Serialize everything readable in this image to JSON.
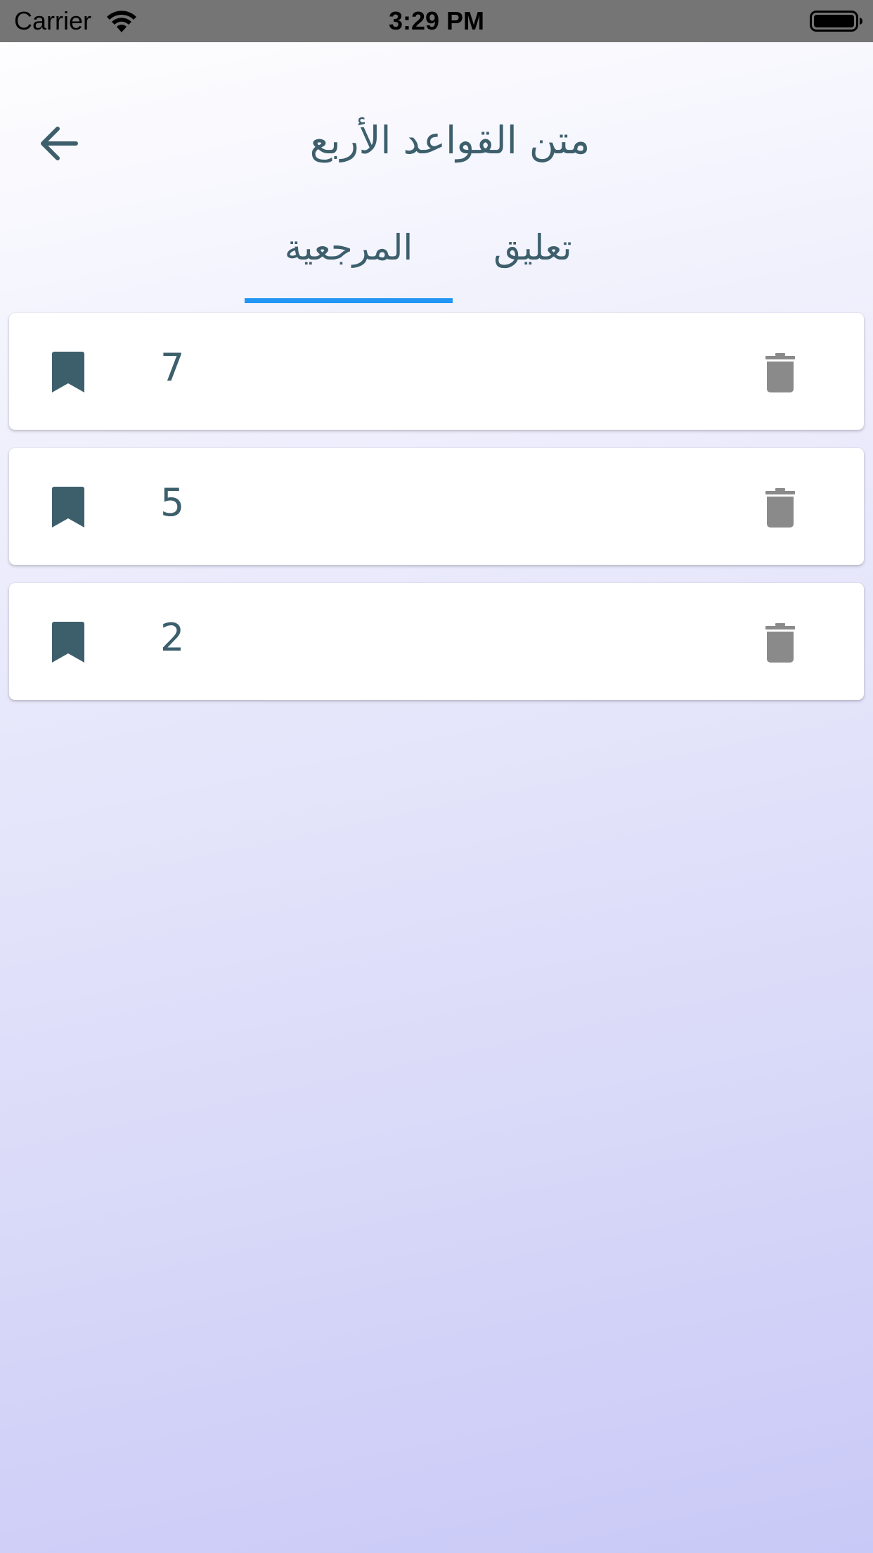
{
  "status_bar": {
    "carrier": "Carrier",
    "time": "3:29 PM"
  },
  "header": {
    "title": "متن القواعد الأربع",
    "back_icon": "arrow-left-icon"
  },
  "tabs": [
    {
      "label": "المرجعية",
      "selected": true
    },
    {
      "label": "تعليق",
      "selected": false
    }
  ],
  "bookmarks": [
    {
      "number": "7"
    },
    {
      "number": "5"
    },
    {
      "number": "2"
    }
  ],
  "colors": {
    "primary_text": "#3d5f6c",
    "tab_indicator": "#2196f3",
    "delete_icon": "#8a8a8a",
    "status_bar": "#757575"
  }
}
